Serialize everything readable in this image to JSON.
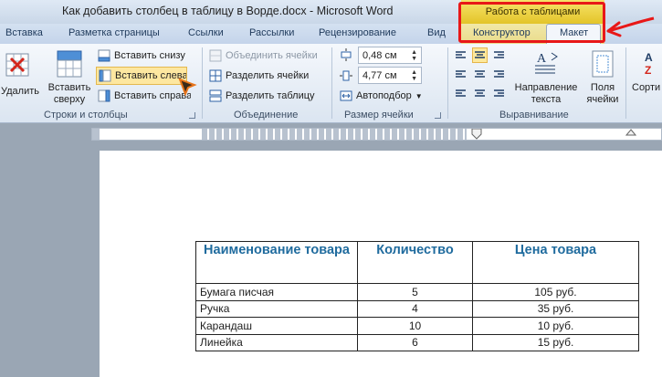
{
  "window": {
    "title": "Как добавить столбец в таблицу в Ворде.docx  -  Microsoft Word",
    "context_group": "Работа с таблицами"
  },
  "tabs": {
    "insert": "Вставка",
    "page_layout": "Разметка страницы",
    "references": "Ссылки",
    "mailings": "Рассылки",
    "review": "Рецензирование",
    "view": "Вид",
    "design": "Конструктор",
    "layout": "Макет"
  },
  "ribbon": {
    "rows_cols": {
      "label": "Строки и столбцы",
      "delete": "Удалить",
      "insert_above_1": "Вставить",
      "insert_above_2": "сверху",
      "insert_below": "Вставить снизу",
      "insert_left": "Вставить слева",
      "insert_right": "Вставить справа"
    },
    "merge": {
      "label": "Объединение",
      "merge_cells": "Объединить ячейки",
      "split_cells": "Разделить ячейки",
      "split_table": "Разделить таблицу"
    },
    "cell_size": {
      "label": "Размер ячейки",
      "height": "0,48 см",
      "width": "4,77 см",
      "autofit": "Автоподбор"
    },
    "alignment": {
      "label": "Выравнивание",
      "text_direction_1": "Направление",
      "text_direction_2": "текста",
      "cell_margins_1": "Поля",
      "cell_margins_2": "ячейки",
      "sort": "Сорти"
    }
  },
  "colors": {
    "accent_header": "#1f6b9e",
    "annotation": "#e81818",
    "context_yellow": "#f0d84a"
  },
  "document": {
    "table": {
      "headers": [
        "Наименование товара",
        "Количество",
        "Цена товара"
      ],
      "rows": [
        [
          "Бумага писчая",
          "5",
          "105 руб."
        ],
        [
          "Ручка",
          "4",
          "35 руб."
        ],
        [
          "Карандаш",
          "10",
          "10 руб."
        ],
        [
          "Линейка",
          "6",
          "15 руб."
        ]
      ]
    }
  }
}
